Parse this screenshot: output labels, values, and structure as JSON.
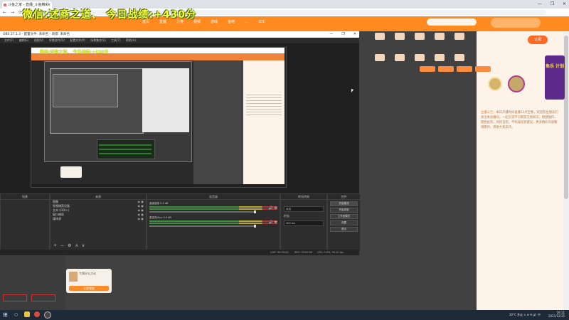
{
  "browser": {
    "tab_title": "斗鱼之家 - 直播_斗鱼精彩直播",
    "tab_close": "×",
    "window_controls": [
      "—",
      "❐",
      "✕"
    ],
    "nav": [
      "←",
      "→",
      "⟳"
    ]
  },
  "stream_title": "微信:述商之道、 今日战绩:+430分",
  "site": {
    "nav_items": [
      "首页",
      "直播",
      "分类",
      "视频",
      "游戏",
      "鱼吧",
      "...",
      "101"
    ],
    "user_badge": "",
    "gift_badge": "订阅"
  },
  "right_panel": {
    "icons": [
      "",
      "",
      "",
      "",
      "",
      "",
      "",
      "",
      "",
      ""
    ],
    "buttons": [
      "",
      "",
      "",
      ""
    ],
    "side_ad": "鱼乐\n计划",
    "notice_head": "主播公告：",
    "notice_text": "本日开播时间直播12点至晚，欢迎各位朋友们关注本直播间，一起交流学习期货交易知识，稳健操作，理性投资，风险自担，不构成投资建议。更多精彩内容敬请期待，感谢大家支持。"
  },
  "left_page": {
    "menu": [
      "",
      "",
      "",
      "",
      "",
      "",
      "",
      "",
      ""
    ],
    "buttons": [
      "",
      ""
    ]
  },
  "promo_card": {
    "title": "专属好礼活动",
    "button": "立即领取"
  },
  "obs": {
    "title": "OBS 27.1.3 - 配置文件: 未命名 - 场景: 未命名",
    "controls": [
      "—",
      "❐",
      "✕"
    ],
    "menu": [
      "文件(F)",
      "编辑(E)",
      "视图(V)",
      "停靠部件(D)",
      "配置文件(P)",
      "场景集合(S)",
      "工具(T)",
      "帮助(H)"
    ],
    "preview_title": "微信:述商之道、 今日战绩:+430分",
    "docks": {
      "scenes": "场景",
      "sources": "来源",
      "mixer": "混音器",
      "transitions": "转场特效",
      "controls": "控件"
    },
    "sources": [
      {
        "label": "图像"
      },
      {
        "label": "视频捕获设备"
      },
      {
        "label": "文本 (GDI+)"
      },
      {
        "label": "窗口捕获"
      },
      {
        "label": "媒体源"
      }
    ],
    "mixer": [
      {
        "name": "桌面音频",
        "value": "0.0 dB"
      },
      {
        "name": "麦克风/Aux",
        "value": "0.0 dB"
      }
    ],
    "transitions": {
      "type": "淡出",
      "duration_label": "时长",
      "duration": "300 ms"
    },
    "control_buttons": [
      "开始推流",
      "开始录制",
      "工作室模式",
      "设置",
      "退出"
    ],
    "status": {
      "live": "LIVE: 00:00:00",
      "rec": "REC: 00:00:00",
      "cpu": "CPU: 0.0%, 30.00 fps"
    },
    "source_toolbar": [
      "+",
      "−",
      "⚙",
      "∧",
      "∨"
    ]
  },
  "taskbar": {
    "start": "⊞",
    "search": "○",
    "weather": "10°C 多云",
    "time": "19:11",
    "date": "2021/12/15",
    "tray": "∧ ⊕ ✉ 🔊 中"
  },
  "colors": {
    "site_orange": "#ff8a1f",
    "overlay_yellow": "#f8ff3b",
    "obs_dark": "#202020"
  }
}
